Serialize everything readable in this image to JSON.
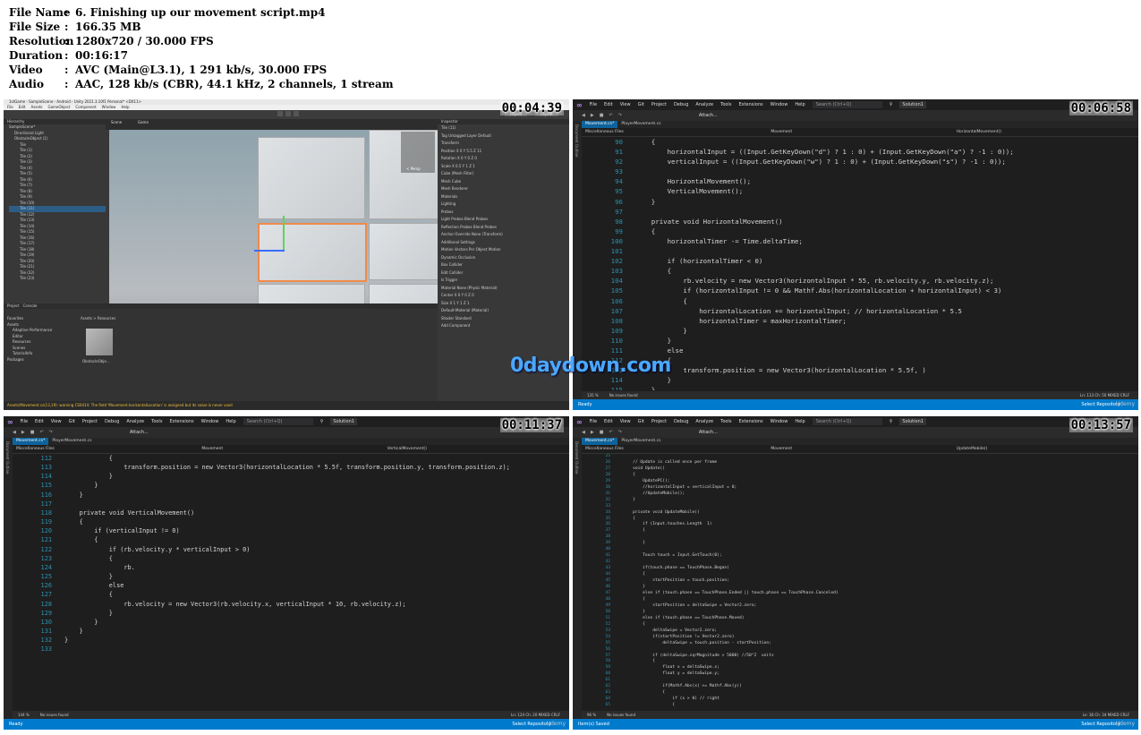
{
  "file_info": [
    {
      "key": "File Name",
      "value": "6. Finishing up our movement script.mp4"
    },
    {
      "key": "File Size",
      "value": "166.35 MB"
    },
    {
      "key": "Resolution",
      "value": "1280x720 / 30.000 FPS"
    },
    {
      "key": "Duration",
      "value": "00:16:17"
    },
    {
      "key": "Video",
      "value": "AVC (Main@L3.1), 1 291 kb/s, 30.000 FPS"
    },
    {
      "key": "Audio",
      "value": "AAC, 128 kb/s (CBR), 44.1 kHz, 2 channels, 1 stream"
    }
  ],
  "watermark": "0daydown.com",
  "udemy": "Udemy",
  "unity": {
    "timestamp": "00:04:39",
    "title": "1stGame - SampleScene - Android - Unity 2021.3.10f1 Personal* <DX11>",
    "menu": [
      "File",
      "Edit",
      "Assets",
      "GameObject",
      "Component",
      "Window",
      "Help"
    ],
    "layers_label": "Layers",
    "layout_label": "Layout",
    "hierarchy_tab": "Hierarchy",
    "scene_tab": "Scene",
    "game_tab": "Game",
    "inspector_tab": "Inspector",
    "project_tab": "Project",
    "console_tab": "Console",
    "hierarchy": [
      "SampleScene*",
      "Directional Light",
      "ObstacleObject (1)",
      "Tile",
      "Tile (1)",
      "Tile (2)",
      "Tile (3)",
      "Tile (4)",
      "Tile (5)",
      "Tile (6)",
      "Tile (7)",
      "Tile (8)",
      "Tile (9)",
      "Tile (10)",
      "Tile (11)",
      "Tile (12)",
      "Tile (13)",
      "Tile (14)",
      "Tile (15)",
      "Tile (16)",
      "Tile (17)",
      "Tile (18)",
      "Tile (19)",
      "Tile (20)",
      "Tile (21)",
      "Tile (22)",
      "Tile (23)"
    ],
    "hierarchy_selected_index": 14,
    "persp_label": "< Persp",
    "inspector": [
      "Tile (11)",
      "Tag Untagged     Layer Default",
      "Transform",
      "Position   X 0   Y 5.5   Z 11",
      "Rotation   X 0   Y 0   Z 0",
      "Scale      X 0.5 Y 1     Z 1",
      "Cube (Mesh Filter)",
      "Mesh   Cube",
      "Mesh Renderer",
      "Materials",
      "Lighting",
      "Probes",
      "Light Probes   Blend Probes",
      "Reflection Probes   Blend Probes",
      "Anchor Override   None (Transform)",
      "Additional Settings",
      "Motion Vectors   Per Object Motion",
      "Dynamic Occlusion",
      "Box Collider",
      "Edit Collider",
      "Is Trigger",
      "Material   None (Physic Material)",
      "Center   X 0   Y 0   Z 0",
      "Size     X 1   Y 1   Z 1",
      "Default-Material (Material)",
      "Shader   Standard",
      "Add Component"
    ],
    "project_tree": [
      "Favorites",
      "Assets",
      "Adaptive Performance",
      "Editor",
      "Resources",
      "Scenes",
      "TutorialInfo",
      "Packages"
    ],
    "breadcrumb": "Assets > Resources",
    "asset_name": "ObstacleObje...",
    "warning": "Assets\\Movement.cs(13,19): warning CS0414: The field 'Movement.horizontalLocation' is assigned but its value is never used"
  },
  "vs_panels": [
    {
      "timestamp": "00:06:58",
      "menu": [
        "File",
        "Edit",
        "View",
        "Git",
        "Project",
        "Debug",
        "Analyze",
        "Tools",
        "Extensions",
        "Window",
        "Help"
      ],
      "search": "Search (Ctrl+Q)",
      "solution": "Solution1",
      "attach": "Attach...",
      "side_label": "Document Outline",
      "tabs": [
        "Movement.cs*",
        "PlayerMovement.cs"
      ],
      "nav": [
        "Miscellaneous Files",
        "Movement",
        "HorizontalMovement()"
      ],
      "zoom": "135 %",
      "issues": "No issues found",
      "position": "Ln: 113   Ch: 50   MIXED   CRLF",
      "status": "Ready",
      "repo": "Select Repository",
      "lines": [
        {
          "n": "90",
          "t": "    {"
        },
        {
          "n": "91",
          "t": "        horizontalInput = ((Input.GetKeyDown(\"d\") ? 1 : 0) + (Input.GetKeyDown(\"a\") ? -1 : 0));"
        },
        {
          "n": "92",
          "t": "        verticalInput = ((Input.GetKeyDown(\"w\") ? 1 : 0) + (Input.GetKeyDown(\"s\") ? -1 : 0));"
        },
        {
          "n": "93",
          "t": ""
        },
        {
          "n": "94",
          "t": "        HorizontalMovement();"
        },
        {
          "n": "95",
          "t": "        VerticalMovement();"
        },
        {
          "n": "96",
          "t": "    }"
        },
        {
          "n": "97",
          "t": ""
        },
        {
          "n": "98",
          "t": "    private void HorizontalMovement()"
        },
        {
          "n": "99",
          "t": "    {"
        },
        {
          "n": "100",
          "t": "        horizontalTimer -= Time.deltaTime;"
        },
        {
          "n": "101",
          "t": ""
        },
        {
          "n": "102",
          "t": "        if (horizontalTimer < 0)"
        },
        {
          "n": "103",
          "t": "        {"
        },
        {
          "n": "104",
          "t": "            rb.velocity = new Vector3(horizontalInput * 55, rb.velocity.y, rb.velocity.z);"
        },
        {
          "n": "105",
          "t": "            if (horizontalInput != 0 && Mathf.Abs(horizontalLocation + horizontalInput) < 3)"
        },
        {
          "n": "106",
          "t": "            {"
        },
        {
          "n": "107",
          "t": "                horizontalLocation += horizontalInput; // horizontalLocation * 5.5"
        },
        {
          "n": "108",
          "t": "                horizontalTimer = maxHorizontalTimer;"
        },
        {
          "n": "109",
          "t": "            }"
        },
        {
          "n": "110",
          "t": "        }"
        },
        {
          "n": "111",
          "t": "        else"
        },
        {
          "n": "112",
          "t": "        {"
        },
        {
          "n": "113",
          "t": "            transform.position = new Vector3(horizontalLocation * 5.5f, )"
        },
        {
          "n": "114",
          "t": "        }"
        },
        {
          "n": "115",
          "t": "    }"
        }
      ]
    },
    {
      "timestamp": "00:11:37",
      "menu": [
        "File",
        "Edit",
        "View",
        "Git",
        "Project",
        "Debug",
        "Analyze",
        "Tools",
        "Extensions",
        "Window",
        "Help"
      ],
      "search": "Search (Ctrl+Q)",
      "solution": "Solution1",
      "attach": "Attach...",
      "side_label": "Document Outline",
      "tabs": [
        "Movement.cs*",
        "PlayerMovement.cs"
      ],
      "nav": [
        "Miscellaneous Files",
        "Movement",
        "VerticalMovement()"
      ],
      "zoom": "144 %",
      "issues": "No issues found",
      "position": "Ln: 124   Ch: 20   MIXED   CRLF",
      "status": "Ready",
      "repo": "Select Repository",
      "lines": [
        {
          "n": "112",
          "t": "            {"
        },
        {
          "n": "113",
          "t": "                transform.position = new Vector3(horizontalLocation * 5.5f, transform.position.y, transform.position.z);"
        },
        {
          "n": "114",
          "t": "            }"
        },
        {
          "n": "115",
          "t": "        }"
        },
        {
          "n": "116",
          "t": "    }"
        },
        {
          "n": "117",
          "t": ""
        },
        {
          "n": "118",
          "t": "    private void VerticalMovement()"
        },
        {
          "n": "119",
          "t": "    {"
        },
        {
          "n": "120",
          "t": "        if (verticalInput != 0)"
        },
        {
          "n": "121",
          "t": "        {"
        },
        {
          "n": "122",
          "t": "            if (rb.velocity.y * verticalInput > 0)"
        },
        {
          "n": "123",
          "t": "            {"
        },
        {
          "n": "124",
          "t": "                rb."
        },
        {
          "n": "125",
          "t": "            }"
        },
        {
          "n": "126",
          "t": "            else"
        },
        {
          "n": "127",
          "t": "            {"
        },
        {
          "n": "128",
          "t": "                rb.velocity = new Vector3(rb.velocity.x, verticalInput * 10, rb.velocity.z);"
        },
        {
          "n": "129",
          "t": "            }"
        },
        {
          "n": "130",
          "t": "        }"
        },
        {
          "n": "131",
          "t": "    }"
        },
        {
          "n": "132",
          "t": "}"
        },
        {
          "n": "133",
          "t": ""
        }
      ]
    },
    {
      "timestamp": "00:13:57",
      "menu": [
        "File",
        "Edit",
        "View",
        "Git",
        "Project",
        "Debug",
        "Analyze",
        "Tools",
        "Extensions",
        "Window",
        "Help"
      ],
      "search": "Search (Ctrl+Q)",
      "solution": "Solution1",
      "attach": "Attach...",
      "side_label": "Document Outline",
      "tabs": [
        "Movement.cs*",
        "PlayerMovement.cs"
      ],
      "nav": [
        "Miscellaneous Files",
        "Movement",
        "UpdateMobile()"
      ],
      "zoom": "96 %",
      "issues": "No issues found",
      "position": "Ln: 36   Ch: 34   MIXED   CRLF",
      "status": "Item(s) Saved",
      "repo": "Select Repository",
      "lines": [
        {
          "n": "25",
          "t": ""
        },
        {
          "n": "26",
          "t": "    // Update is called once per frame"
        },
        {
          "n": "27",
          "t": "    void Update()"
        },
        {
          "n": "28",
          "t": "    {"
        },
        {
          "n": "29",
          "t": "        UpdatePC();"
        },
        {
          "n": "30",
          "t": "        //horizontalInput = verticalInput = 0;"
        },
        {
          "n": "31",
          "t": "        //UpdateMobile();"
        },
        {
          "n": "32",
          "t": "    }"
        },
        {
          "n": "33",
          "t": ""
        },
        {
          "n": "34",
          "t": "    private void UpdateMobile()"
        },
        {
          "n": "35",
          "t": "    {"
        },
        {
          "n": "36",
          "t": "        if (Input.touches.Length  1)"
        },
        {
          "n": "37",
          "t": "        {"
        },
        {
          "n": "38",
          "t": ""
        },
        {
          "n": "39",
          "t": "        }"
        },
        {
          "n": "40",
          "t": ""
        },
        {
          "n": "41",
          "t": "        Touch touch = Input.GetTouch(0);"
        },
        {
          "n": "42",
          "t": ""
        },
        {
          "n": "43",
          "t": "        if(touch.phase == TouchPhase.Began)"
        },
        {
          "n": "44",
          "t": "        {"
        },
        {
          "n": "45",
          "t": "            startPosition = touch.position;"
        },
        {
          "n": "46",
          "t": "        }"
        },
        {
          "n": "47",
          "t": "        else if (touch.phase == TouchPhase.Ended || touch.phase == TouchPhase.Canceled)"
        },
        {
          "n": "48",
          "t": "        {"
        },
        {
          "n": "49",
          "t": "            startPosition = deltaSwipe = Vector2.zero;"
        },
        {
          "n": "50",
          "t": "        }"
        },
        {
          "n": "51",
          "t": "        else if (touch.phase == TouchPhase.Moved)"
        },
        {
          "n": "52",
          "t": "        {"
        },
        {
          "n": "53",
          "t": "            deltaSwipe = Vector2.zero;"
        },
        {
          "n": "54",
          "t": "            if(startPosition != Vector2.zero)"
        },
        {
          "n": "55",
          "t": "                deltaSwipe = touch.position - startPosition;"
        },
        {
          "n": "56",
          "t": ""
        },
        {
          "n": "57",
          "t": "            if (deltaSwipe.sqrMagnitude > 5000) //50^2  units"
        },
        {
          "n": "58",
          "t": "            {"
        },
        {
          "n": "59",
          "t": "                float x = deltaSwipe.x;"
        },
        {
          "n": "60",
          "t": "                float y = deltaSwipe.y;"
        },
        {
          "n": "61",
          "t": ""
        },
        {
          "n": "62",
          "t": "                if(Mathf.Abs(x) >= Mathf.Abs(y))"
        },
        {
          "n": "63",
          "t": "                {"
        },
        {
          "n": "64",
          "t": "                    if (x > 0) // right"
        },
        {
          "n": "65",
          "t": "                    {"
        }
      ]
    }
  ]
}
